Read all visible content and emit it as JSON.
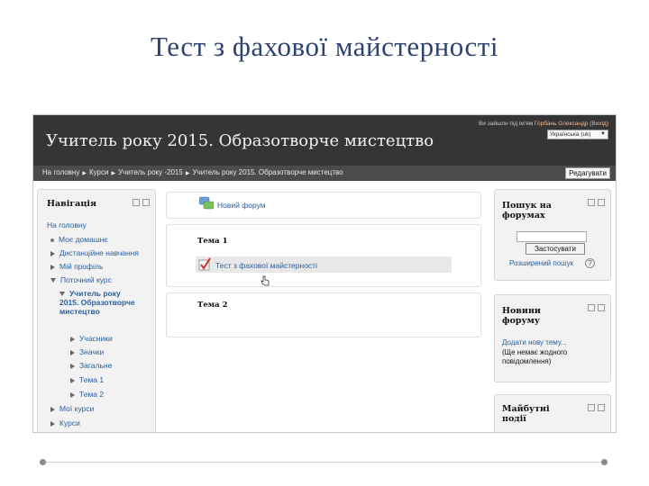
{
  "slide": {
    "title": "Тест з фахової майстерності"
  },
  "site": {
    "title": "Учитель року 2015. Образотворче мистецтво",
    "login": {
      "prefix": "Ви зайшли під ім'ям",
      "user": "Горбань Олександр",
      "logout": "(Вихід)"
    },
    "language": "Українська (uk)"
  },
  "navbar": {
    "crumbs": [
      "На головну",
      "Курси",
      "Учитель року -2015",
      "Учитель року 2015. Образотворче мистецтво"
    ],
    "edit_button": "Редагувати"
  },
  "nav_block": {
    "title": "Навігація",
    "items": {
      "home": "На головну",
      "dashboard": "Моє домашнє",
      "distance": "Дистанційне навчання",
      "profile": "Мій профіль",
      "current": "Поточний курс",
      "course": "Учитель року 2015. Образотворче мистецтво",
      "participants": "Учасники",
      "badges": "Значки",
      "general": "Загальне",
      "topic1": "Тема 1",
      "topic2": "Тема 2",
      "my_courses": "Мої курси",
      "courses": "Курси"
    }
  },
  "main": {
    "new_forum": "Новий форум",
    "topic1": "Тема 1",
    "quiz": "Тест з фахової майстерності",
    "topic2": "Тема 2"
  },
  "search_block": {
    "title": "Пошук на форумах",
    "button": "Застосувати",
    "advanced": "Розширений пошук"
  },
  "news_block": {
    "title": "Новини форуму",
    "add_topic": "Додати нову тему...",
    "empty": "(Ще немає жодного повідомлення)"
  },
  "events_block": {
    "title": "Майбутні події"
  }
}
